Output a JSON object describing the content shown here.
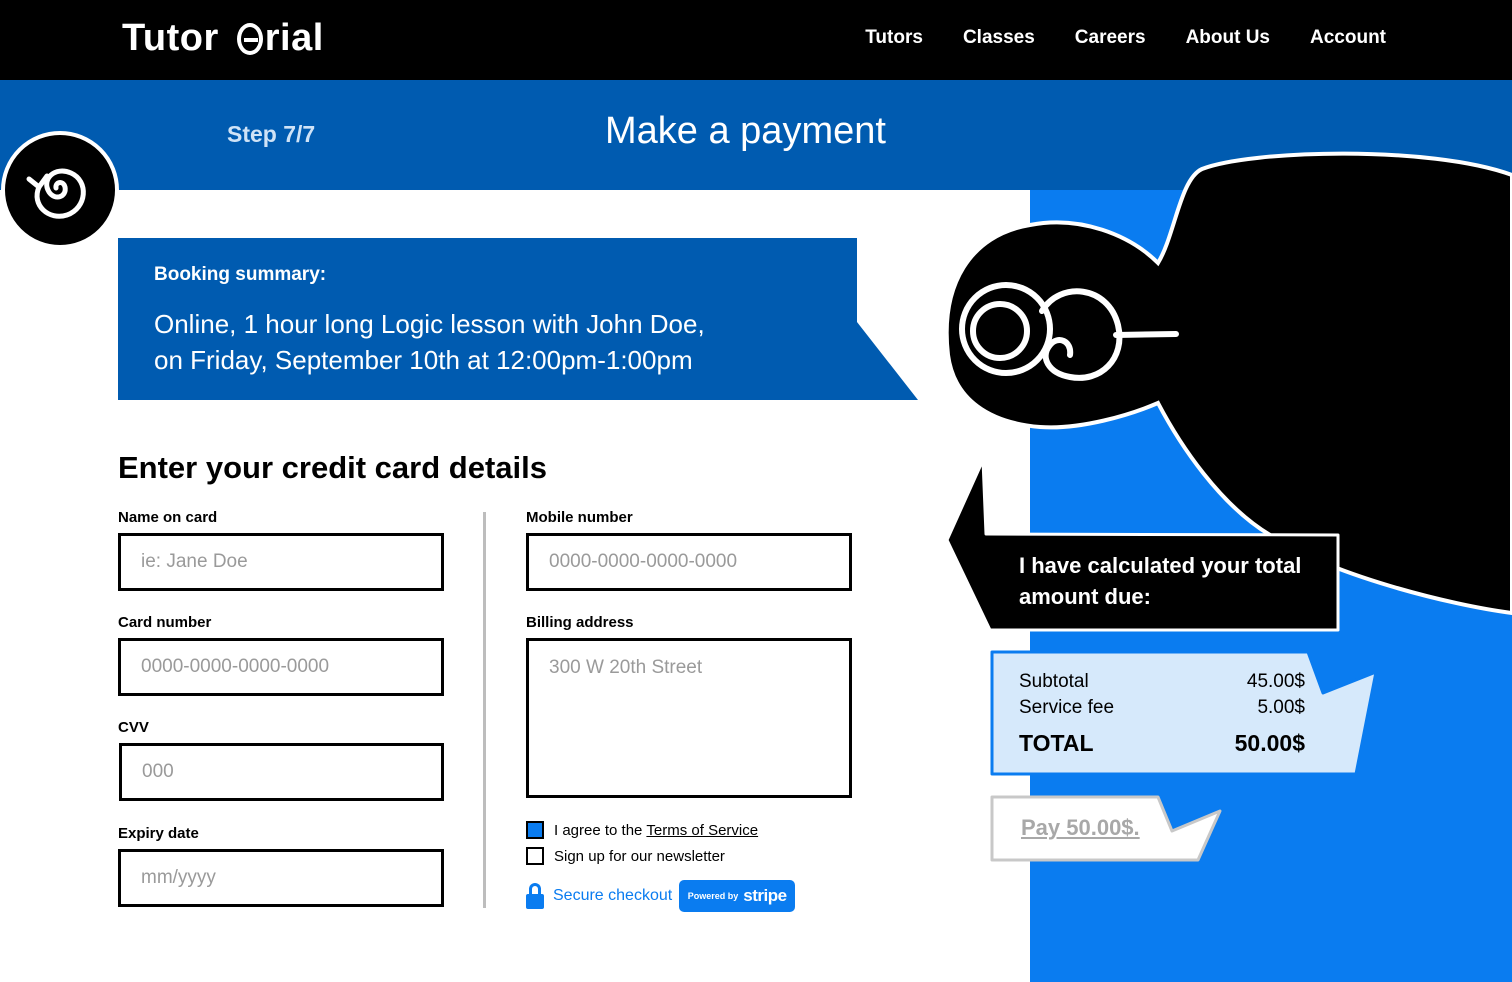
{
  "brand": {
    "name_part1": "Tutor",
    "name_part2": "rial"
  },
  "nav": {
    "items": [
      "Tutors",
      "Classes",
      "Careers",
      "About Us",
      "Account"
    ]
  },
  "header": {
    "step": "Step 7/7",
    "title": "Make a payment"
  },
  "summary": {
    "label": "Booking summary:",
    "line1": "Online, 1 hour long Logic lesson with John Doe,",
    "line2": "on Friday, September 10th at 12:00pm-1:00pm"
  },
  "form": {
    "title": "Enter your credit card details",
    "name_label": "Name on card",
    "name_placeholder": "ie: Jane Doe",
    "card_label": "Card number",
    "card_placeholder": "0000-0000-0000-0000",
    "cvv_label": "CVV",
    "cvv_placeholder": "000",
    "expiry_label": "Expiry date",
    "expiry_placeholder": "mm/yyyy",
    "mobile_label": "Mobile number",
    "mobile_placeholder": "0000-0000-0000-0000",
    "billing_label": "Billing address",
    "billing_placeholder": "300 W 20th Street",
    "agree_text": "I agree to the",
    "tos_link": "Terms of Service",
    "agree_checked": true,
    "newsletter_text": "Sign up for our newsletter",
    "newsletter_checked": false,
    "secure_text": "Secure checkout",
    "stripe_small": "Powered by",
    "stripe_big": "stripe"
  },
  "assistant": {
    "message": "I have calculated your total amount due:"
  },
  "totals": {
    "subtotal_label": "Subtotal",
    "subtotal_value": "45.00$",
    "fee_label": "Service fee",
    "fee_value": "5.00$",
    "total_label": "TOTAL",
    "total_value": "50.00$"
  },
  "pay_button": {
    "label": "Pay 50.00$."
  },
  "colors": {
    "nav_bg": "#000000",
    "band": "#005bb0",
    "accent": "#0a7cf0",
    "totals_bg": "#d6e9fb"
  }
}
